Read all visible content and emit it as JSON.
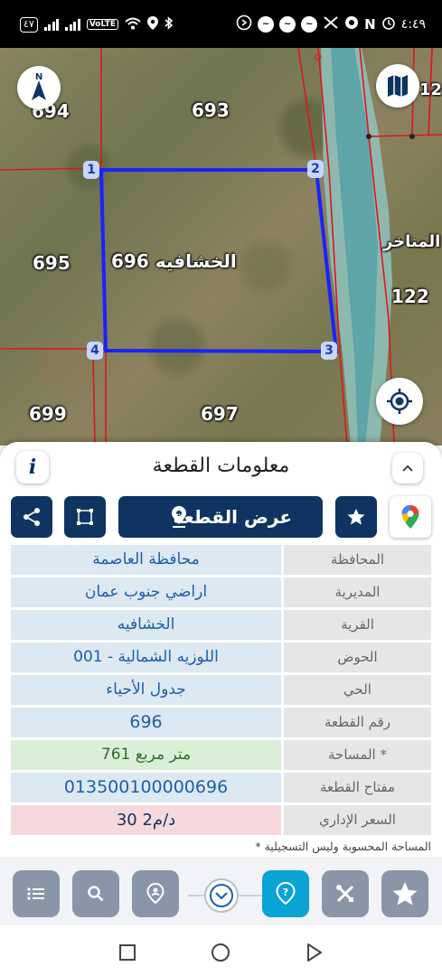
{
  "status_bar": {
    "battery": "٤٧",
    "volte": "VoLTE",
    "time": "٤:٤٩",
    "notif_badge": "N"
  },
  "map": {
    "parcels": {
      "p694": "694",
      "p693": "693",
      "p695": "695",
      "p696": "الخشافيه 696",
      "p699": "699",
      "p697": "697",
      "p122": "122",
      "p122b": "12",
      "manakher": "المناخر"
    },
    "vertices": [
      "1",
      "2",
      "3",
      "4"
    ]
  },
  "panel": {
    "info_label": "i",
    "title": "معلومات القطعة",
    "show_plot_label": "عرض القطعة",
    "rows": [
      {
        "label": "المحافظة",
        "value": "محافظة العاصمة"
      },
      {
        "label": "المديرية",
        "value": "اراضي جنوب عمان"
      },
      {
        "label": "القرية",
        "value": "الخشافيه"
      },
      {
        "label": "الحوض",
        "value": "اللوزيه الشمالية - 001"
      },
      {
        "label": "الحي",
        "value": "جدول الأحياء"
      },
      {
        "label": "رقم القطعة",
        "value": "696"
      },
      {
        "label": "المساحة *",
        "value": "761  متر مربع"
      },
      {
        "label": "مفتاح القطعة",
        "value": "013500100000696"
      },
      {
        "label": "السعر الإداري",
        "value": "30 د/م2"
      }
    ],
    "note": "* المساحة المحسوبة وليس التسجيلية"
  },
  "colors": {
    "primary": "#0f3462",
    "accent": "#0aa3d6",
    "parcel_outline": "#1a22ff",
    "boundary": "#e0141e"
  }
}
